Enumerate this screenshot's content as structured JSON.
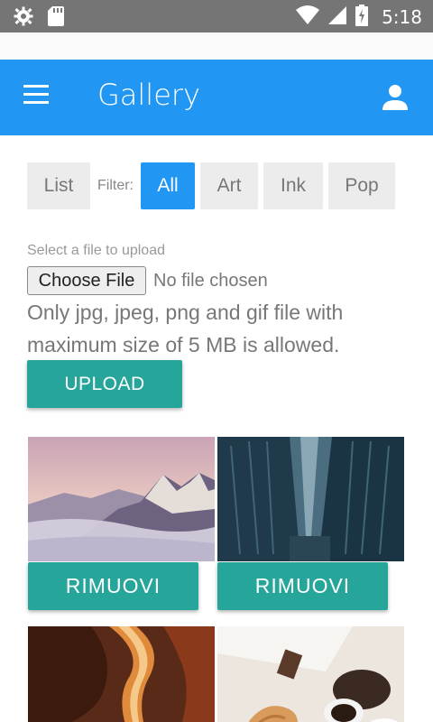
{
  "status_bar": {
    "time": "5:18",
    "icons": [
      "settings-icon",
      "sd-card-icon",
      "wifi-icon",
      "signal-icon",
      "battery-icon"
    ]
  },
  "app_bar": {
    "title": "Gallery",
    "color": "#2196f3"
  },
  "filters": {
    "list_label": "List",
    "filter_label": "Filter:",
    "options": [
      {
        "label": "All",
        "active": true
      },
      {
        "label": "Art",
        "active": false
      },
      {
        "label": "Ink",
        "active": false
      },
      {
        "label": "Pop",
        "active": false
      }
    ],
    "active_color": "#2196f3"
  },
  "upload": {
    "label": "Select a file to upload",
    "choose_file_label": "Choose File",
    "no_file_text": "No file chosen",
    "note": "Only jpg, jpeg, png and gif file with maximum size of 5 MB is allowed.",
    "button_label": "UPLOAD",
    "button_color": "#26a69a"
  },
  "gallery": {
    "items": [
      {
        "image": "mountains-photo",
        "remove_label": "RIMUOVI"
      },
      {
        "image": "city-street-photo",
        "remove_label": "RIMUOVI"
      },
      {
        "image": "canyon-photo",
        "remove_label": ""
      },
      {
        "image": "coffee-croissant-photo",
        "remove_label": ""
      }
    ]
  }
}
